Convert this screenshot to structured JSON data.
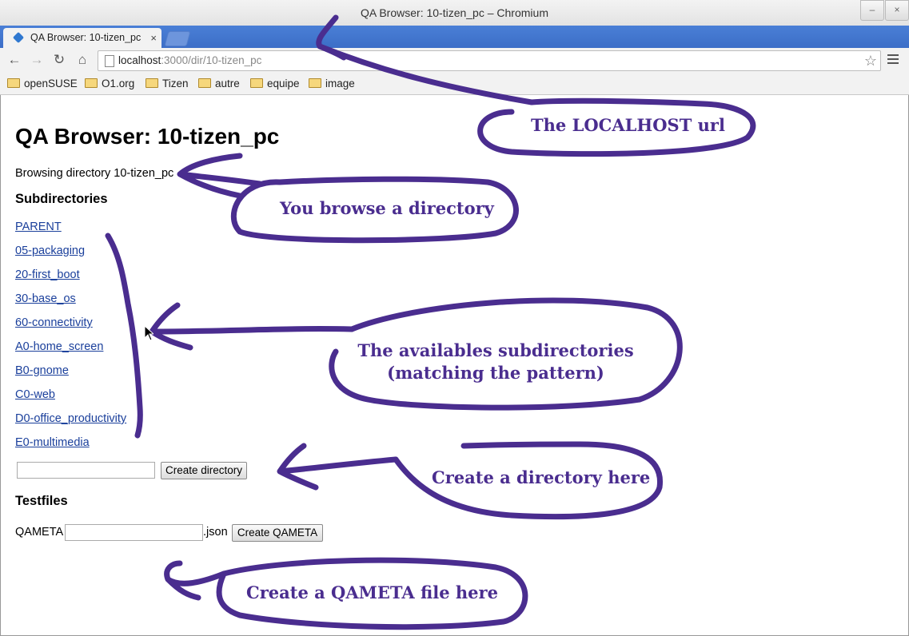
{
  "window": {
    "title": "QA Browser: 10-tizen_pc – Chromium",
    "minimize": "–",
    "close": "×"
  },
  "tab": {
    "title": "QA Browser: 10-tizen_pc",
    "close": "×"
  },
  "toolbar": {
    "back": "←",
    "forward": "→",
    "reload": "↻",
    "home": "⌂",
    "url_host": "localhost",
    "url_path": ":3000/dir/10-tizen_pc",
    "star": "☆"
  },
  "bookmarks": [
    "openSUSE",
    "O1.org",
    "Tizen",
    "autre",
    "equipe",
    "image"
  ],
  "page": {
    "title": "QA Browser: 10-tizen_pc",
    "browsing": "Browsing directory 10-tizen_pc",
    "subdirectories_heading": "Subdirectories",
    "subdirectories": [
      "PARENT",
      "05-packaging",
      "20-first_boot",
      "30-base_os",
      "60-connectivity",
      "A0-home_screen",
      "B0-gnome",
      "C0-web",
      "D0-office_productivity",
      "E0-multimedia"
    ],
    "create_directory_label": "Create directory",
    "new_directory_value": "",
    "testfiles_heading": "Testfiles",
    "qameta_label": "QAMETA",
    "qameta_value": "",
    "json_suffix": ".json",
    "create_qameta_label": "Create QAMETA"
  },
  "annotations": {
    "url_note": "The LOCALHOST url",
    "browse_note": "You browse a directory",
    "subdirs_note_line1": "The availables subdirectories",
    "subdirs_note_line2": "(matching the pattern)",
    "create_dir_note": "Create a directory here",
    "qameta_note": "Create a QAMETA file here",
    "color": "#4a2d8f"
  },
  "colors": {
    "tabstrip": "#3c6ec7",
    "link": "#1a3f9b"
  }
}
